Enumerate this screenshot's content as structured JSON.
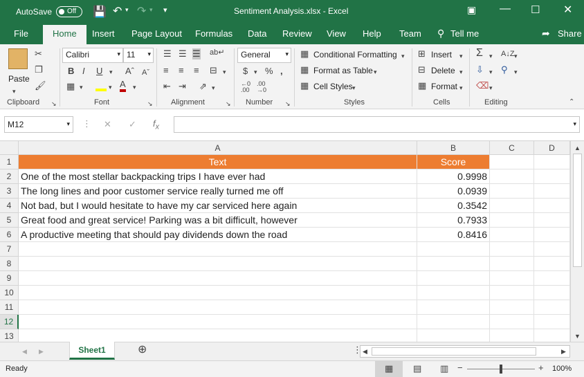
{
  "titlebar": {
    "autosave_label": "AutoSave",
    "autosave_state": "Off",
    "document_title": "Sentiment Analysis.xlsx  -  Excel",
    "colors": {
      "brand": "#217346"
    }
  },
  "tabs": [
    "File",
    "Home",
    "Insert",
    "Page Layout",
    "Formulas",
    "Data",
    "Review",
    "View",
    "Help",
    "Team"
  ],
  "tell_me": "Tell me",
  "share": "Share",
  "ribbon": {
    "clipboard": {
      "paste": "Paste",
      "title": "Clipboard"
    },
    "font": {
      "name": "Calibri",
      "size": "11",
      "title": "Font"
    },
    "alignment": {
      "title": "Alignment"
    },
    "number": {
      "format": "General",
      "title": "Number"
    },
    "styles": {
      "conditional": "Conditional Formatting",
      "format_table": "Format as Table",
      "cell_styles": "Cell Styles",
      "title": "Styles"
    },
    "cells": {
      "insert": "Insert",
      "delete": "Delete",
      "format": "Format",
      "title": "Cells"
    },
    "editing": {
      "title": "Editing"
    }
  },
  "formula_bar": {
    "name_box": "M12",
    "formula": ""
  },
  "columns": [
    "A",
    "B",
    "C",
    "D"
  ],
  "rows": [
    "1",
    "2",
    "3",
    "4",
    "5",
    "6",
    "7",
    "8",
    "9",
    "10",
    "11",
    "12",
    "13"
  ],
  "selected_row": "12",
  "table": {
    "headers": [
      "Text",
      "Score"
    ],
    "data": [
      [
        "One of the most stellar backpacking trips I have ever had",
        "0.9998"
      ],
      [
        "The long lines and poor customer service really turned me off",
        "0.0939"
      ],
      [
        "Not bad, but I would hesitate to have my car serviced here again",
        "0.3542"
      ],
      [
        "Great food and great service! Parking was a bit difficult, however",
        "0.7933"
      ],
      [
        "A productive meeting that should pay dividends down the road",
        "0.8416"
      ]
    ],
    "header_color": "#ed7d31"
  },
  "sheet_tab": "Sheet1",
  "status": {
    "text": "Ready",
    "zoom": "100%"
  }
}
